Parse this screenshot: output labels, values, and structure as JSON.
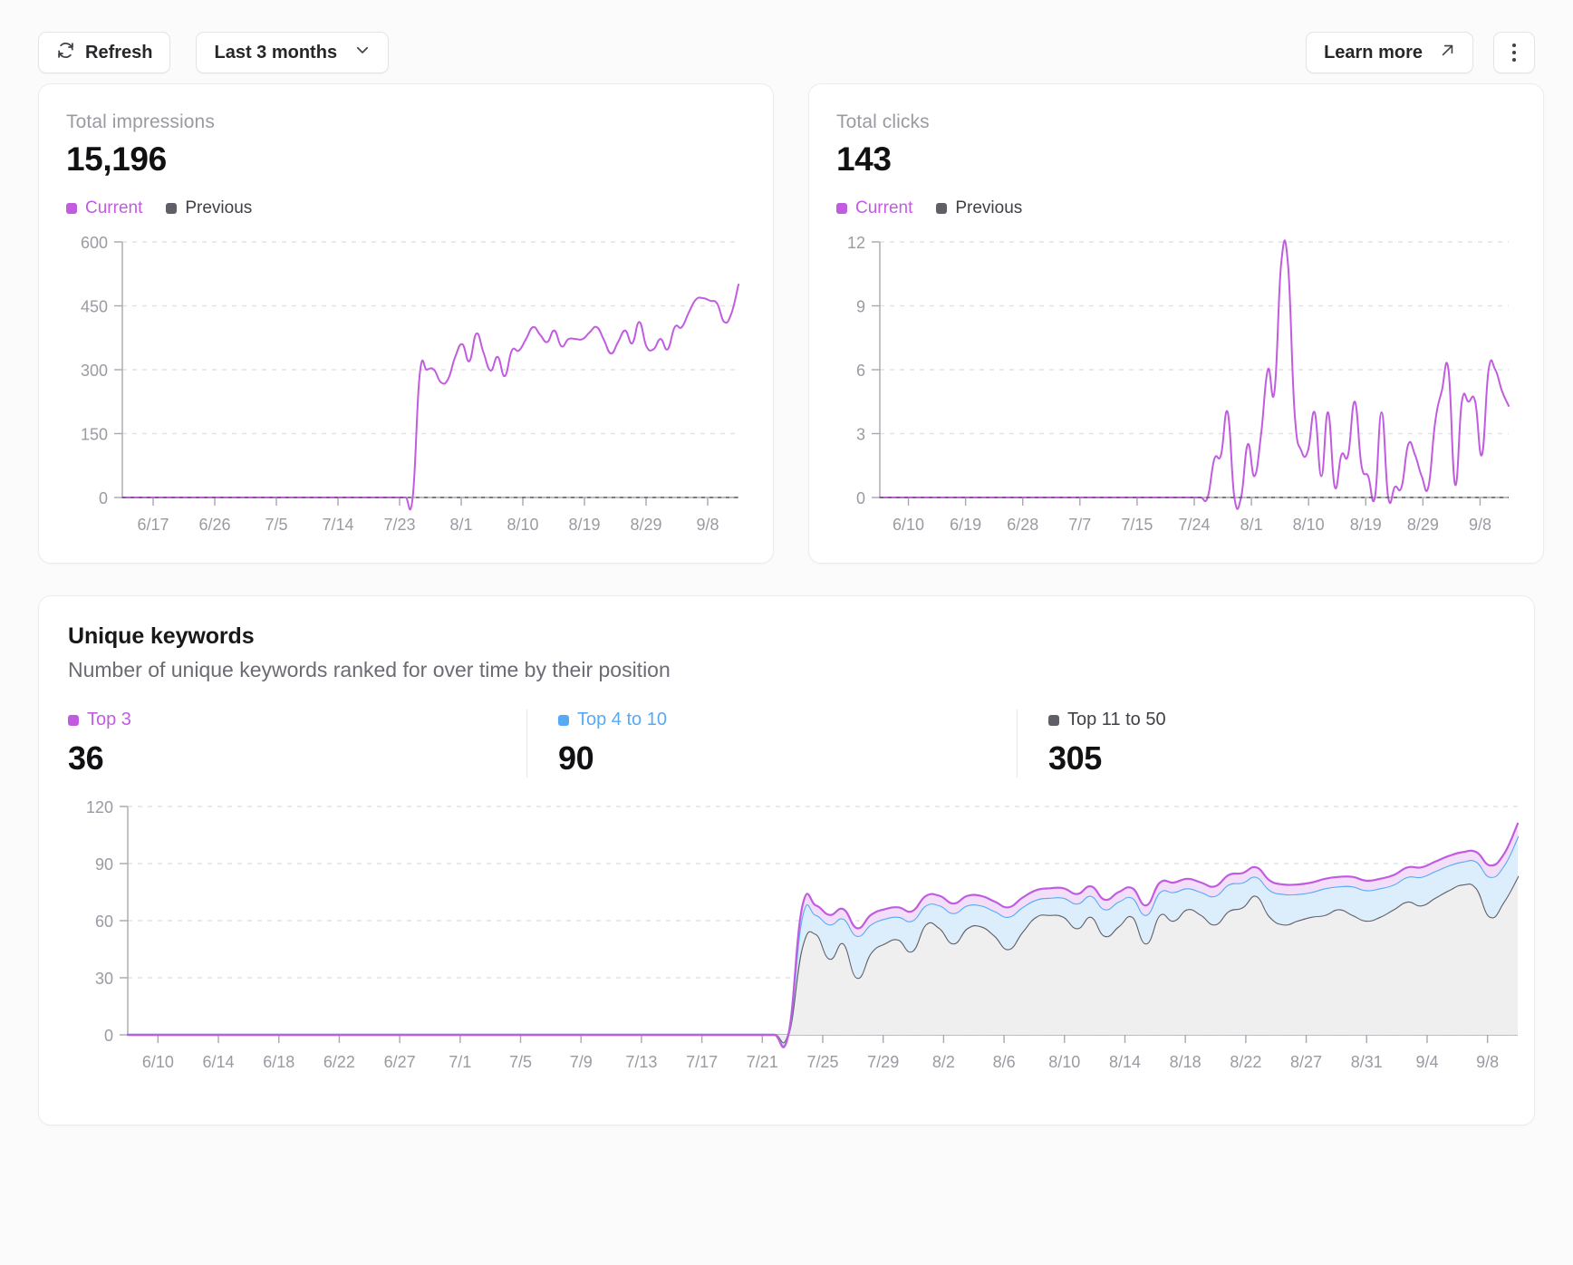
{
  "toolbar": {
    "refresh_label": "Refresh",
    "range_label": "Last 3 months",
    "learn_more_label": "Learn more",
    "refresh_icon": "refresh-icon",
    "chevron_icon": "chevron-down-icon",
    "external_icon": "external-link-icon",
    "overflow_icon": "more-vertical-icon"
  },
  "colors": {
    "current": "#c15ce0",
    "previous": "#5f5f68",
    "top3": "#c15ce0",
    "top4to10": "#56aaf5",
    "top11to50": "#5f5f68",
    "top3_fill": "#f3def9",
    "top4to10_fill": "#dcedfb",
    "top11to50_fill": "#efeff0",
    "grid": "#e3e3e6",
    "axis": "#a8a8ae",
    "text_muted": "#9a9aa2"
  },
  "cards": {
    "impressions": {
      "label": "Total impressions",
      "value": "15,196",
      "legend": [
        {
          "label": "Current",
          "color": "#c15ce0"
        },
        {
          "label": "Previous",
          "color": "#5f5f68"
        }
      ]
    },
    "clicks": {
      "label": "Total clicks",
      "value": "143",
      "legend": [
        {
          "label": "Current",
          "color": "#c15ce0"
        },
        {
          "label": "Previous",
          "color": "#5f5f68"
        }
      ]
    }
  },
  "unique_keywords": {
    "title": "Unique keywords",
    "subtitle": "Number of unique keywords ranked for over time by their position",
    "metrics": [
      {
        "label": "Top 3",
        "value": "36",
        "color": "#c15ce0"
      },
      {
        "label": "Top 4 to 10",
        "value": "90",
        "color": "#56aaf5"
      },
      {
        "label": "Top 11 to 50",
        "value": "305",
        "color": "#5f5f68"
      }
    ]
  },
  "chart_data": [
    {
      "id": "impressions",
      "type": "line",
      "title": "Total impressions",
      "xlabel": "",
      "ylabel": "",
      "ylim": [
        0,
        600
      ],
      "yticks": [
        0,
        150,
        300,
        450,
        600
      ],
      "xticks": [
        "6/17",
        "6/26",
        "7/5",
        "7/14",
        "7/23",
        "8/1",
        "8/10",
        "8/19",
        "8/29",
        "9/8"
      ],
      "grid": true,
      "legend": [
        "Current",
        "Previous"
      ],
      "series": [
        {
          "name": "Current",
          "color": "#c15ce0",
          "values": [
            0,
            0,
            0,
            0,
            0,
            0,
            0,
            0,
            0,
            0,
            0,
            0,
            0,
            0,
            0,
            0,
            0,
            0,
            0,
            0,
            0,
            0,
            0,
            0,
            0,
            0,
            0,
            0,
            0,
            0,
            0,
            0,
            0,
            0,
            0,
            0,
            0,
            0,
            0,
            0,
            0,
            0,
            290,
            300,
            300,
            270,
            278,
            330,
            360,
            320,
            385,
            340,
            298,
            330,
            285,
            345,
            345,
            372,
            400,
            382,
            365,
            392,
            355,
            372,
            372,
            372,
            388,
            400,
            370,
            338,
            365,
            392,
            362,
            412,
            355,
            348,
            372,
            348,
            400,
            400,
            435,
            465,
            468,
            462,
            455,
            412,
            432,
            500
          ]
        },
        {
          "name": "Previous",
          "color": "#5f5f68",
          "values": [
            0,
            0,
            0,
            0,
            0,
            0,
            0,
            0,
            0,
            0,
            0,
            0,
            0,
            0,
            0,
            0,
            0,
            0,
            0,
            0,
            0,
            0,
            0,
            0,
            0,
            0,
            0,
            0,
            0,
            0,
            0,
            0,
            0,
            0,
            0,
            0,
            0,
            0,
            0,
            0,
            0,
            0,
            0,
            0,
            0,
            0,
            0,
            0,
            0,
            0,
            0,
            0,
            0,
            0,
            0,
            0,
            0,
            0,
            0,
            0,
            0,
            0,
            0,
            0,
            0,
            0,
            0,
            0,
            0,
            0,
            0,
            0,
            0,
            0,
            0,
            0,
            0,
            0,
            0,
            0,
            0,
            0,
            0,
            0,
            0,
            0
          ]
        }
      ]
    },
    {
      "id": "clicks",
      "type": "line",
      "title": "Total clicks",
      "xlabel": "",
      "ylabel": "",
      "ylim": [
        0,
        12
      ],
      "yticks": [
        0,
        3,
        6,
        9,
        12
      ],
      "xticks": [
        "6/10",
        "6/19",
        "6/28",
        "7/7",
        "7/15",
        "7/24",
        "8/1",
        "8/10",
        "8/19",
        "8/29",
        "9/8"
      ],
      "grid": true,
      "legend": [
        "Current",
        "Previous"
      ],
      "series": [
        {
          "name": "Current",
          "color": "#c15ce0",
          "values": [
            0,
            0,
            0,
            0,
            0,
            0,
            0,
            0,
            0,
            0,
            0,
            0,
            0,
            0,
            0,
            0,
            0,
            0,
            0,
            0,
            0,
            0,
            0,
            0,
            0,
            0,
            0,
            0,
            0,
            0,
            0,
            0,
            0,
            0,
            0,
            0,
            0,
            0,
            0,
            0,
            0,
            0,
            0,
            0,
            0,
            0,
            0,
            0,
            0,
            0,
            1.8,
            2,
            4,
            0,
            0,
            2.5,
            1,
            3,
            6,
            5,
            11,
            11,
            4,
            2.2,
            2.2,
            4,
            1,
            4,
            0.5,
            2,
            2,
            4.5,
            1.5,
            1,
            0,
            4,
            0,
            0.5,
            0.5,
            2.5,
            2,
            1,
            0.5,
            3.5,
            5,
            6,
            0.6,
            4.5,
            4.5,
            4.5,
            2,
            6,
            6,
            5,
            4.3
          ]
        },
        {
          "name": "Previous",
          "color": "#5f5f68",
          "values": [
            0,
            0,
            0,
            0,
            0,
            0,
            0,
            0,
            0,
            0,
            0,
            0,
            0,
            0,
            0,
            0,
            0,
            0,
            0,
            0,
            0,
            0,
            0,
            0,
            0,
            0,
            0,
            0,
            0,
            0,
            0,
            0,
            0,
            0,
            0,
            0,
            0,
            0,
            0,
            0,
            0,
            0,
            0,
            0,
            0,
            0,
            0,
            0,
            0,
            0,
            0,
            0,
            0,
            0,
            0,
            0,
            0,
            0,
            0,
            0,
            0,
            0,
            0,
            0,
            0,
            0,
            0,
            0,
            0,
            0,
            0,
            0,
            0,
            0,
            0,
            0,
            0,
            0,
            0,
            0,
            0,
            0,
            0,
            0,
            0,
            0,
            0,
            0,
            0,
            0,
            0,
            0,
            0,
            0,
            0,
            0,
            0
          ]
        }
      ]
    },
    {
      "id": "unique_keywords",
      "type": "area",
      "stacked": true,
      "title": "Unique keywords",
      "subtitle": "Number of unique keywords ranked for over time by their position",
      "xlabel": "",
      "ylabel": "",
      "ylim": [
        0,
        120
      ],
      "yticks": [
        0,
        30,
        60,
        90,
        120
      ],
      "xticks": [
        "6/10",
        "6/14",
        "6/18",
        "6/22",
        "6/27",
        "7/1",
        "7/5",
        "7/9",
        "7/13",
        "7/17",
        "7/21",
        "7/25",
        "7/29",
        "8/2",
        "8/6",
        "8/10",
        "8/14",
        "8/18",
        "8/22",
        "8/27",
        "8/31",
        "9/4",
        "9/8"
      ],
      "grid": true,
      "legend": [
        "Top 3",
        "Top 4 to 10",
        "Top 11 to 50"
      ],
      "series": [
        {
          "name": "Top 11 to 50",
          "color": "#5f5f68",
          "fill": "#efeff0",
          "values": [
            0,
            0,
            0,
            0,
            0,
            0,
            0,
            0,
            0,
            0,
            0,
            0,
            0,
            0,
            0,
            0,
            0,
            0,
            0,
            0,
            0,
            0,
            0,
            0,
            0,
            0,
            0,
            0,
            0,
            0,
            0,
            0,
            0,
            0,
            0,
            0,
            0,
            0,
            0,
            0,
            0,
            0,
            0,
            0,
            0,
            0,
            0,
            0,
            0,
            46,
            53,
            40,
            48,
            30,
            43,
            48,
            50,
            44,
            58,
            56,
            48,
            56,
            57,
            52,
            45,
            54,
            62,
            63,
            62,
            56,
            62,
            52,
            57,
            62,
            48,
            63,
            60,
            66,
            63,
            58,
            65,
            67,
            73,
            62,
            58,
            60,
            62,
            63,
            66,
            63,
            60,
            62,
            66,
            70,
            68,
            72,
            76,
            79,
            77,
            62,
            70,
            83
          ]
        },
        {
          "name": "Top 4 to 10",
          "color": "#56aaf5",
          "fill": "#dcedfb",
          "values": [
            0,
            0,
            0,
            0,
            0,
            0,
            0,
            0,
            0,
            0,
            0,
            0,
            0,
            0,
            0,
            0,
            0,
            0,
            0,
            0,
            0,
            0,
            0,
            0,
            0,
            0,
            0,
            0,
            0,
            0,
            0,
            0,
            0,
            0,
            0,
            0,
            0,
            0,
            0,
            0,
            0,
            0,
            0,
            0,
            0,
            0,
            0,
            0,
            0,
            16,
            10,
            18,
            13,
            22,
            15,
            13,
            12,
            16,
            10,
            12,
            16,
            12,
            11,
            13,
            17,
            13,
            9,
            9,
            10,
            13,
            11,
            14,
            13,
            10,
            15,
            12,
            15,
            11,
            12,
            15,
            14,
            13,
            10,
            14,
            16,
            14,
            13,
            14,
            12,
            15,
            16,
            15,
            13,
            13,
            15,
            14,
            13,
            12,
            14,
            21,
            19,
            21
          ]
        },
        {
          "name": "Top 3",
          "color": "#c15ce0",
          "fill": "#f3def9",
          "values": [
            0,
            0,
            0,
            0,
            0,
            0,
            0,
            0,
            0,
            0,
            0,
            0,
            0,
            0,
            0,
            0,
            0,
            0,
            0,
            0,
            0,
            0,
            0,
            0,
            0,
            0,
            0,
            0,
            0,
            0,
            0,
            0,
            0,
            0,
            0,
            0,
            0,
            0,
            0,
            0,
            0,
            0,
            0,
            0,
            0,
            0,
            0,
            0,
            0,
            5,
            5,
            5,
            5,
            4,
            5,
            5,
            5,
            5,
            5,
            5,
            5,
            5,
            5,
            5,
            5,
            5,
            5,
            5,
            5,
            5,
            5,
            5,
            5,
            5,
            5,
            5,
            5,
            5,
            5,
            5,
            5,
            5,
            5,
            5,
            5,
            5,
            5,
            5,
            5,
            5,
            5,
            5,
            5,
            5,
            5,
            5,
            5,
            5,
            5,
            6,
            6,
            7
          ]
        }
      ]
    }
  ]
}
